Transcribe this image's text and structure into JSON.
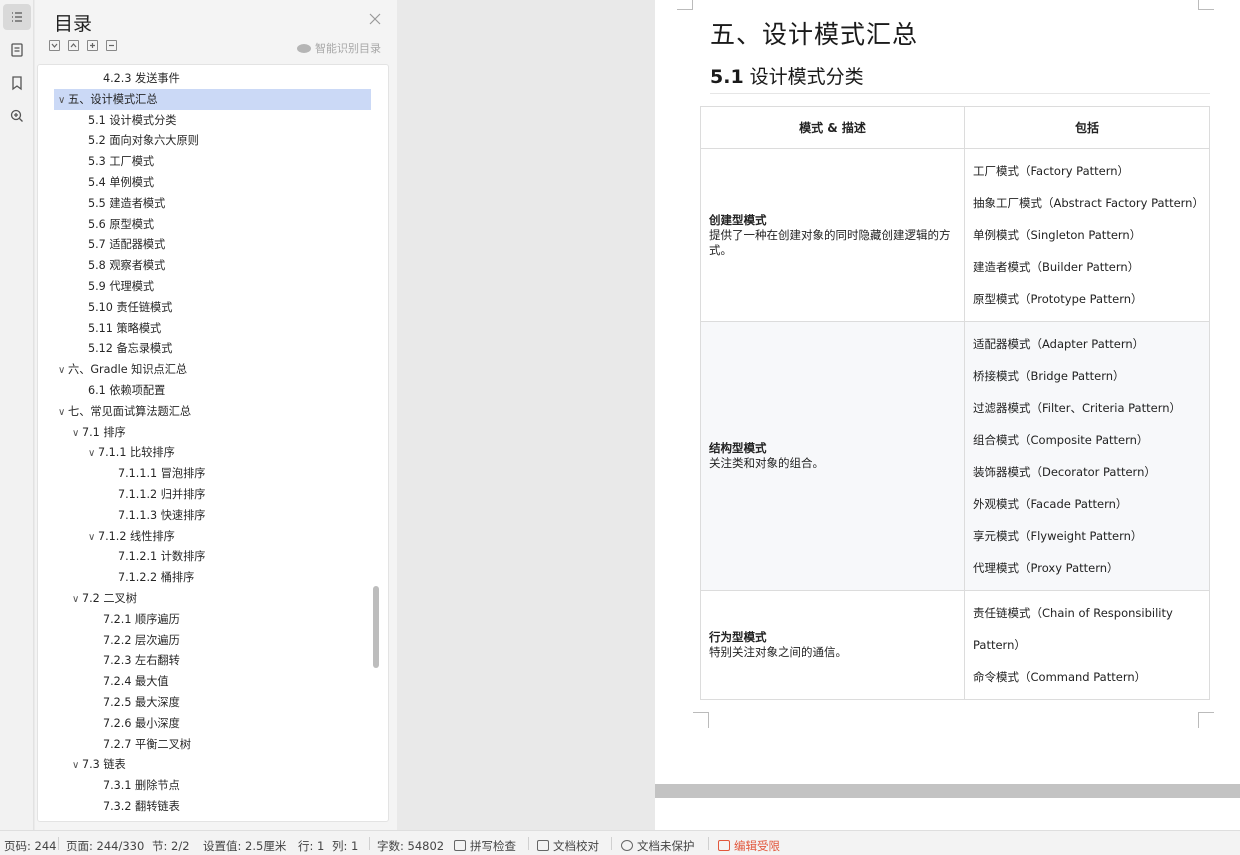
{
  "toc_panel": {
    "title": "目录",
    "smart_label": "智能识别目录",
    "items": [
      {
        "label": "4.2.3 发送事件",
        "level": 3,
        "chevron": ""
      },
      {
        "label": "五、设计模式汇总",
        "level": 1,
        "chevron": "∨",
        "selected": true
      },
      {
        "label": "5.1 设计模式分类",
        "level": 2,
        "chevron": ""
      },
      {
        "label": "5.2 面向对象六大原则",
        "level": 2,
        "chevron": ""
      },
      {
        "label": "5.3 工厂模式",
        "level": 2,
        "chevron": ""
      },
      {
        "label": "5.4 单例模式",
        "level": 2,
        "chevron": ""
      },
      {
        "label": "5.5 建造者模式",
        "level": 2,
        "chevron": ""
      },
      {
        "label": "5.6 原型模式",
        "level": 2,
        "chevron": ""
      },
      {
        "label": "5.7 适配器模式",
        "level": 2,
        "chevron": ""
      },
      {
        "label": "5.8 观察者模式",
        "level": 2,
        "chevron": ""
      },
      {
        "label": "5.9 代理模式",
        "level": 2,
        "chevron": ""
      },
      {
        "label": "5.10 责任链模式",
        "level": 2,
        "chevron": ""
      },
      {
        "label": "5.11 策略模式",
        "level": 2,
        "chevron": ""
      },
      {
        "label": "5.12 备忘录模式",
        "level": 2,
        "chevron": ""
      },
      {
        "label": "六、Gradle 知识点汇总",
        "level": 1,
        "chevron": "∨"
      },
      {
        "label": "6.1 依赖项配置",
        "level": 2,
        "chevron": ""
      },
      {
        "label": "七、常见面试算法题汇总",
        "level": 1,
        "chevron": "∨"
      },
      {
        "label": "7.1 排序",
        "level": 2,
        "chevron": "∨"
      },
      {
        "label": "7.1.1 比较排序",
        "level": 3,
        "chevron": "∨"
      },
      {
        "label": "7.1.1.1 冒泡排序",
        "level": 4,
        "chevron": ""
      },
      {
        "label": "7.1.1.2 归并排序",
        "level": 4,
        "chevron": ""
      },
      {
        "label": "7.1.1.3 快速排序",
        "level": 4,
        "chevron": ""
      },
      {
        "label": "7.1.2 线性排序",
        "level": 3,
        "chevron": "∨"
      },
      {
        "label": "7.1.2.1 计数排序",
        "level": 4,
        "chevron": ""
      },
      {
        "label": "7.1.2.2 桶排序",
        "level": 4,
        "chevron": ""
      },
      {
        "label": "7.2 二叉树",
        "level": 2,
        "chevron": "∨"
      },
      {
        "label": "7.2.1 顺序遍历",
        "level": 3,
        "chevron": ""
      },
      {
        "label": "7.2.2 层次遍历",
        "level": 3,
        "chevron": ""
      },
      {
        "label": "7.2.3 左右翻转",
        "level": 3,
        "chevron": ""
      },
      {
        "label": "7.2.4 最大值",
        "level": 3,
        "chevron": ""
      },
      {
        "label": "7.2.5 最大深度",
        "level": 3,
        "chevron": ""
      },
      {
        "label": "7.2.6 最小深度",
        "level": 3,
        "chevron": ""
      },
      {
        "label": "7.2.7 平衡二叉树",
        "level": 3,
        "chevron": ""
      },
      {
        "label": "7.3 链表",
        "level": 2,
        "chevron": "∨"
      },
      {
        "label": "7.3.1 删除节点",
        "level": 3,
        "chevron": ""
      },
      {
        "label": "7.3.2 翻转链表",
        "level": 3,
        "chevron": ""
      }
    ]
  },
  "document": {
    "heading1": "五、设计模式汇总",
    "heading2_num": "5.1",
    "heading2_text": "设计模式分类",
    "table": {
      "headers": [
        "模式 & 描述",
        "包括"
      ],
      "rows": [
        {
          "category": "创建型模式",
          "description": "提供了一种在创建对象的同时隐藏创建逻辑的方式。",
          "patterns": [
            "工厂模式（Factory Pattern）",
            "抽象工厂模式（Abstract Factory Pattern）",
            "单例模式（Singleton Pattern）",
            "建造者模式（Builder Pattern）",
            "原型模式（Prototype Pattern）"
          ]
        },
        {
          "category": "结构型模式",
          "description": "关注类和对象的组合。",
          "patterns": [
            "适配器模式（Adapter Pattern）",
            "桥接模式（Bridge Pattern）",
            "过滤器模式（Filter、Criteria Pattern）",
            "组合模式（Composite Pattern）",
            "装饰器模式（Decorator Pattern）",
            "外观模式（Facade Pattern）",
            "享元模式（Flyweight Pattern）",
            "代理模式（Proxy Pattern）"
          ]
        },
        {
          "category": "行为型模式",
          "description": "特别关注对象之间的通信。",
          "patterns": [
            "责任链模式（Chain of Responsibility",
            "Pattern）",
            "命令模式（Command Pattern）"
          ]
        }
      ]
    }
  },
  "status_bar": {
    "page_code": "页码: 244",
    "page_total": "页面: 244/330",
    "section": "节: 2/2",
    "setting": "设置值: 2.5厘米",
    "row": "行: 1",
    "col": "列: 1",
    "word_count": "字数: 54802",
    "spell_check": "拼写检查",
    "doc_proof": "文档校对",
    "doc_protect": "文档未保护",
    "edit_restrict": "编辑受限"
  },
  "colors": {
    "selection": "#cbd9f6",
    "restrict_red": "#e2573c"
  }
}
